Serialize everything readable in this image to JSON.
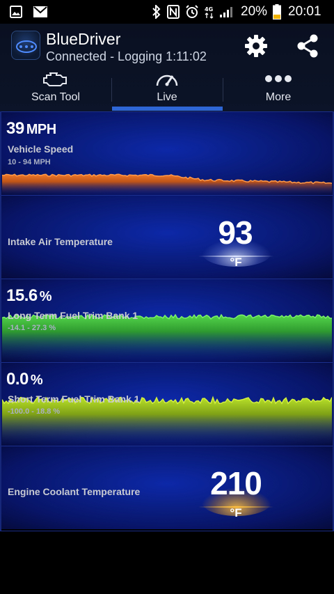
{
  "status_bar": {
    "battery_percent": "20%",
    "time": "20:01",
    "icons": [
      "image-icon",
      "mail-icon",
      "bluetooth-icon",
      "nfc-icon",
      "alarm-icon",
      "4g-icon",
      "signal-icon",
      "battery-icon"
    ]
  },
  "header": {
    "title": "BlueDriver",
    "subtitle": "Connected - Logging 1:11:02",
    "settings_icon": "gear-icon",
    "share_icon": "share-icon"
  },
  "tabs": [
    {
      "label": "Scan Tool",
      "icon": "engine-icon",
      "active": false
    },
    {
      "label": "Live",
      "icon": "speedometer-icon",
      "active": true
    },
    {
      "label": "More",
      "icon": "more-dots-icon",
      "active": false
    }
  ],
  "gauges": [
    {
      "type": "graph",
      "value": "39",
      "unit": "MPH",
      "name": "Vehicle Speed",
      "range": "10 - 94 MPH",
      "color": "#e0621a",
      "fill_level": 0.22
    },
    {
      "type": "digital",
      "value": "93",
      "unit": "°F",
      "name": "Intake Air Temperature",
      "glow_color": "#ffffff"
    },
    {
      "type": "graph",
      "value": "15.6",
      "unit": "%",
      "name": "Long Term Fuel Trim Bank 1",
      "range": "-14.1 - 27.3 %",
      "color": "#45c43c",
      "fill_level": 0.55
    },
    {
      "type": "graph",
      "value": "0.0",
      "unit": "%",
      "name": "Short Term Fuel Trim Bank 1",
      "range": "-100.0 - 18.8 %",
      "color": "#a7d61e",
      "fill_level": 0.55
    },
    {
      "type": "digital",
      "value": "210",
      "unit": "°F",
      "name": "Engine Coolant Temperature",
      "glow_color": "#ffb020"
    }
  ],
  "colors": {
    "accent": "#2f66d6",
    "panel": "#0a1f86"
  }
}
